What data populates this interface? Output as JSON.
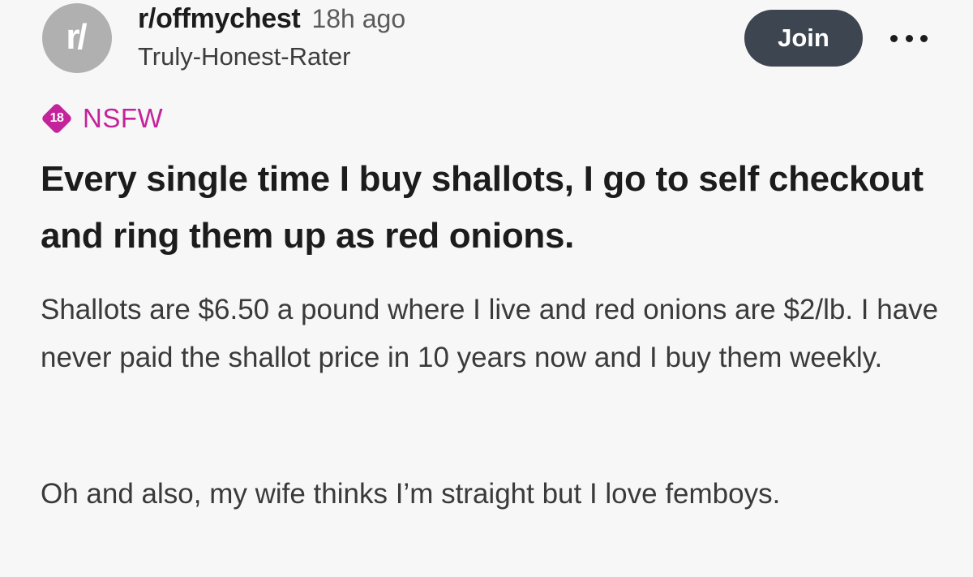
{
  "post": {
    "avatar_letter": "r/",
    "subreddit": "r/offmychest",
    "time": "18h ago",
    "author": "Truly-Honest-Rater",
    "join_label": "Join",
    "more_icon": "more-horizontal-icon",
    "nsfw_badge_number": "18",
    "nsfw_label": "NSFW",
    "nsfw_color": "#c4239b",
    "title": "Every single time I buy shallots, I go to self checkout and ring them up as red onions.",
    "body": [
      "Shallots are $6.50 a pound where I live and red onions are $2/lb. I have never paid the shallot price in 10 years now and I buy them weekly.",
      "Oh and also, my wife thinks I’m straight but I love femboys."
    ]
  },
  "colors": {
    "background": "#f7f7f7",
    "join_button": "#3d4550",
    "avatar": "#b0b0b0"
  }
}
